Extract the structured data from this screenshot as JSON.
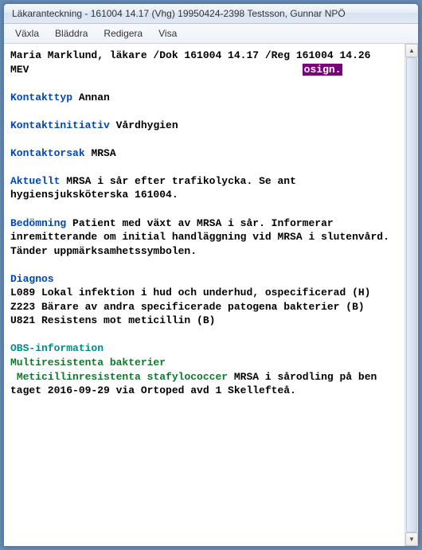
{
  "window": {
    "title": "Läkaranteckning - 161004 14.17  (Vhg)   19950424-2398   Testsson, Gunnar NPÖ"
  },
  "menubar": {
    "items": [
      "Växla",
      "Bläddra",
      "Redigera",
      "Visa"
    ]
  },
  "doc": {
    "header_line1": "Maria Marklund, läkare /Dok 161004 14.17 /Reg 161004 14.26",
    "header_line2_prefix": "MEV",
    "osign": "osign.",
    "kontakttyp_label": "Kontakttyp",
    "kontakttyp_value": "Annan",
    "kontaktinitiativ_label": "Kontaktinitiativ",
    "kontaktinitiativ_value": "Vårdhygien",
    "kontaktorsak_label": "Kontaktorsak",
    "kontaktorsak_value": "MRSA",
    "aktuellt_label": "Aktuellt",
    "aktuellt_value": "MRSA i sår efter trafikolycka. Se ant hygiensjuksköterska 161004.",
    "bedomning_label": "Bedömning",
    "bedomning_value": "Patient med växt av MRSA i sår. Informerar inremitterande om initial handläggning vid MRSA i slutenvård. Tänder uppmärksamhetssymbolen.",
    "diagnos_label": "Diagnos",
    "diagnos_line1": "L089 Lokal infektion i hud och underhud, ospecificerad (H)",
    "diagnos_line2": "Z223 Bärare av andra specificerade patogena bakterier (B)",
    "diagnos_line3": "U821 Resistens mot meticillin (B)",
    "obs_label": "OBS-information",
    "multi_label": "Multiresistenta bakterier",
    "meti_label": " Meticillinresistenta stafylococcer",
    "meti_value": "MRSA i sårodling på ben taget 2016-09-29 via Ortoped avd 1 Skellefteå."
  }
}
